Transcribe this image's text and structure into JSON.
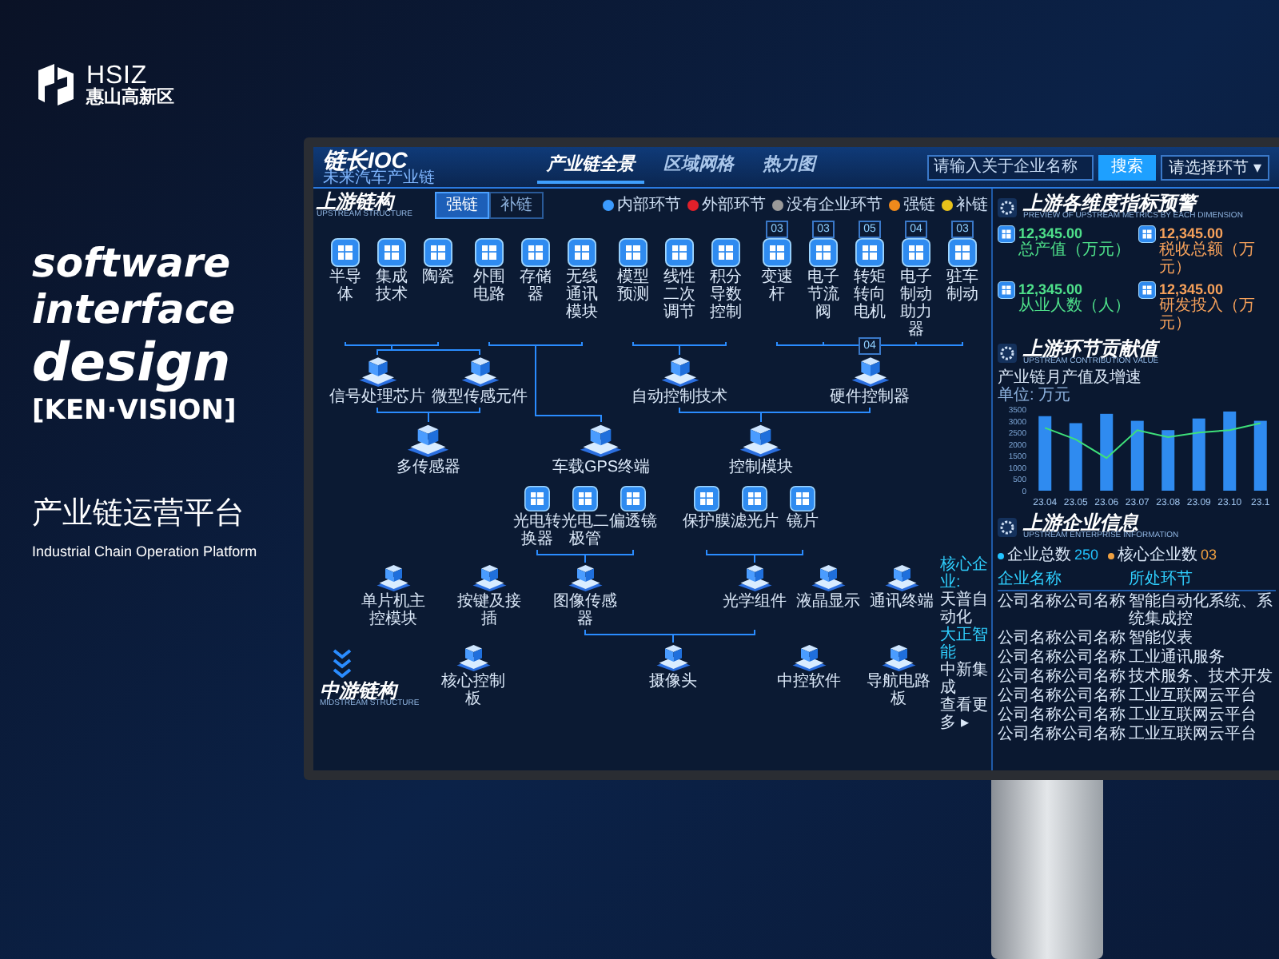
{
  "poster": {
    "logo": {
      "latin": "HSIZ",
      "chinese": "惠山高新区"
    },
    "headline": [
      "software",
      "interface",
      "design"
    ],
    "brand": "[KEN·VISION]",
    "title": "产业链运营平台",
    "subtitle": "Industrial Chain Operation Platform"
  },
  "dashboard": {
    "header": {
      "logo": "链长IOC",
      "logo_subtitle": "未来汽车产业链",
      "tabs": [
        {
          "label": "产业链全景",
          "selected": true
        },
        {
          "label": "区域网格",
          "selected": false
        },
        {
          "label": "热力图",
          "selected": false
        }
      ],
      "search": {
        "placeholder": "请输入关于企业名称"
      },
      "search_button": "搜索",
      "filter": {
        "value": "请选择环节",
        "caret": "▾"
      }
    },
    "upstream": {
      "title": "上游链构",
      "subtitle": "UPSTREAM STRUCTURE",
      "toggles": [
        {
          "label": "强链",
          "selected": true
        },
        {
          "label": "补链",
          "selected": false
        }
      ],
      "legend": [
        {
          "label": "内部环节",
          "color": "#3b9bff"
        },
        {
          "label": "外部环节",
          "color": "#e0202a"
        },
        {
          "label": "没有企业环节",
          "color": "#9a9a9a"
        },
        {
          "label": "强链",
          "color": "#f08a1c"
        },
        {
          "label": "补链",
          "color": "#e8c21a"
        }
      ],
      "tiers": [
        {
          "kind": "tile",
          "nodes": [
            {
              "label": "半导体"
            },
            {
              "label": "集成技术"
            },
            {
              "label": "陶瓷"
            },
            {
              "label": "外围电路"
            },
            {
              "label": "存储器"
            },
            {
              "label": "无线通讯模块"
            },
            {
              "label": "模型预测"
            },
            {
              "label": "线性二次调节"
            },
            {
              "label": "积分导数控制"
            },
            {
              "label": "变速杆",
              "badge": "03"
            },
            {
              "label": "电子节流阀",
              "badge": "03"
            },
            {
              "label": "转矩转向电机",
              "badge": "05"
            },
            {
              "label": "电子制动助力器",
              "badge": "04"
            },
            {
              "label": "驻车制动",
              "badge": "03"
            }
          ]
        },
        {
          "kind": "platform",
          "nodes": [
            {
              "label": "信号处理芯片"
            },
            {
              "label": "微型传感元件"
            },
            {
              "label": "自动控制技术"
            },
            {
              "label": "硬件控制器",
              "badge": "04"
            }
          ]
        },
        {
          "kind": "platform",
          "nodes": [
            {
              "label": "多传感器"
            },
            {
              "label": "车载GPS终端"
            },
            {
              "label": "控制模块"
            }
          ]
        },
        {
          "kind": "tile",
          "nodes": [
            {
              "label": "光电转换器"
            },
            {
              "label": "光电二极管"
            },
            {
              "label": "偏透镜"
            },
            {
              "label": "保护膜"
            },
            {
              "label": "滤光片"
            },
            {
              "label": "镜片"
            }
          ]
        },
        {
          "kind": "platform",
          "nodes": [
            {
              "label": "单片机主控模块"
            },
            {
              "label": "按键及接插"
            },
            {
              "label": "图像传感器"
            },
            {
              "label": "光学组件"
            },
            {
              "label": "液晶显示"
            },
            {
              "label": "通讯终端"
            }
          ]
        },
        {
          "kind": "platform",
          "nodes": [
            {
              "label": "核心控制板"
            },
            {
              "label": "摄像头"
            },
            {
              "label": "中控软件"
            },
            {
              "label": "导航电路板"
            }
          ]
        }
      ],
      "note": {
        "title": "核心企业:",
        "companies": [
          {
            "name": "天普自动化",
            "highlighted": false
          },
          {
            "name": "大正智能",
            "highlighted": true
          },
          {
            "name": "中新集成",
            "highlighted": false
          }
        ],
        "more": "查看更多 ▸"
      }
    },
    "midstream": {
      "title": "中游链构",
      "subtitle": "MIDSTREAM STRUCTURE"
    },
    "metrics_panel": {
      "title": "上游各维度指标预警",
      "subtitle": "PREVIEW OF UPSTREAM METRICS BY EACH DIMENSION",
      "metrics": [
        {
          "value": "12,345.00",
          "label": "总产值（万元）",
          "color": "#4ee08a"
        },
        {
          "value": "12,345.00",
          "label": "税收总额（万元）",
          "color": "#f5a05a"
        },
        {
          "value": "12,345.00",
          "label": "从业人数（人）",
          "color": "#4ee08a"
        },
        {
          "value": "12,345.00",
          "label": "研发投入（万元）",
          "color": "#f5a05a"
        }
      ]
    },
    "contribution": {
      "title": "上游环节贡献值",
      "subtitle": "UPSTREAM CONTRIBUTION VALUE",
      "chart_caption": "产业链月产值及增速",
      "unit": "单位: 万元",
      "chart_data": {
        "type": "bar",
        "categories": [
          "23.04",
          "23.05",
          "23.06",
          "23.07",
          "23.08",
          "23.09",
          "23.10",
          "23.1"
        ],
        "ylim": [
          0,
          3500
        ],
        "yticks": [
          0,
          500,
          1000,
          1500,
          2000,
          2500,
          3000,
          3500
        ],
        "series": [
          {
            "color": "#2f8bf0",
            "values": [
              3200,
              2900,
              3300,
              3000,
              2600,
              3100,
              3400,
              3000
            ]
          },
          {
            "type": "line",
            "color": "#3ee07a",
            "values": [
              2700,
              2200,
              1400,
              2600,
              2300,
              2500,
              2600,
              2900
            ]
          }
        ]
      }
    },
    "enterprise": {
      "title": "上游企业信息",
      "subtitle": "UPSTREAM ENTERPRISE INFORMATION",
      "stats": [
        {
          "label": "企业总数",
          "value": "250",
          "color": "#22c3ff"
        },
        {
          "label": "核心企业数",
          "value": "03",
          "color": "#f0a040"
        }
      ],
      "table": {
        "columns": [
          "企业名称",
          "所处环节"
        ],
        "rows": [
          [
            "公司名称公司名称",
            "智能自动化系统、系统集成控"
          ],
          [
            "公司名称公司名称",
            "智能仪表"
          ],
          [
            "公司名称公司名称",
            "工业通讯服务"
          ],
          [
            "公司名称公司名称",
            "技术服务、技术开发"
          ],
          [
            "公司名称公司名称",
            "工业互联网云平台"
          ],
          [
            "公司名称公司名称",
            "工业互联网云平台"
          ],
          [
            "公司名称公司名称",
            "工业互联网云平台"
          ]
        ]
      }
    }
  }
}
